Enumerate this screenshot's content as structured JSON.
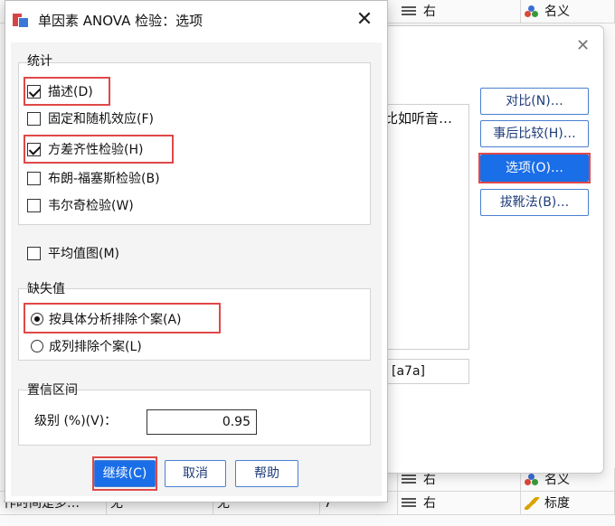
{
  "background": {
    "top_row": {
      "align_text": "右",
      "measure_text": "名义"
    },
    "bottom_rows": [
      {
        "col1": "",
        "col2": "",
        "col3": "",
        "col4": "",
        "align_text": "右",
        "measure_text": "名义"
      },
      {
        "col1": "作时间是多…",
        "col2": "无",
        "col3": "无",
        "col4": "7",
        "align_text": "右",
        "measure_text": "标度"
      }
    ]
  },
  "back_dialog": {
    "list_text": "比如听音…",
    "field_text": "[a7a]",
    "buttons": [
      "对比(N)…",
      "事后比较(H)…",
      "选项(O)…",
      "拔靴法(B)…"
    ]
  },
  "dialog": {
    "title": "单因素 ANOVA 检验：选项",
    "close_symbol": "✕",
    "statistics": {
      "label": "统计",
      "items": [
        {
          "label": "描述(D)",
          "checked": true
        },
        {
          "label": "固定和随机效应(F)",
          "checked": false
        },
        {
          "label": "方差齐性检验(H)",
          "checked": true
        },
        {
          "label": "布朗-福塞斯检验(B)",
          "checked": false
        },
        {
          "label": "韦尔奇检验(W)",
          "checked": false
        }
      ]
    },
    "means_plot": {
      "label": "平均值图(M)",
      "checked": false
    },
    "missing": {
      "label": "缺失值",
      "options": [
        {
          "label": "按具体分析排除个案(A)",
          "selected": true
        },
        {
          "label": "成列排除个案(L)",
          "selected": false
        }
      ]
    },
    "confidence": {
      "label": "置信区间",
      "level_label": "级别 (%)(V)：",
      "level_value": "0.95"
    },
    "buttons": {
      "continue": "继续(C)",
      "cancel": "取消",
      "help": "帮助"
    }
  }
}
